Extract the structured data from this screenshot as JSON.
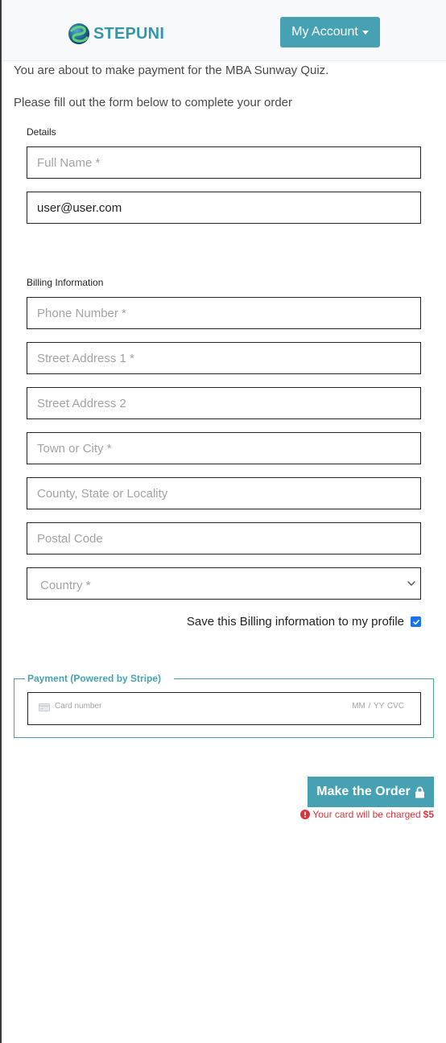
{
  "header": {
    "brand": "STEPUNI",
    "account_button": "My Account"
  },
  "intro": {
    "line1": "You are about to make payment for the MBA Sunway Quiz.",
    "line2": "Please fill out the form below to complete your order"
  },
  "details": {
    "label": "Details",
    "full_name_placeholder": "Full Name *",
    "email_value": "user@user.com"
  },
  "billing": {
    "label": "Billing Information",
    "phone_placeholder": "Phone Number *",
    "street1_placeholder": "Street Address 1 *",
    "street2_placeholder": "Street Address 2",
    "town_placeholder": "Town or City *",
    "county_placeholder": "County, State or Locality",
    "postal_placeholder": "Postal Code",
    "country_selected": "Country *",
    "save_label": "Save this Billing information to my profile",
    "save_checked": true
  },
  "payment": {
    "legend": "Payment (Powered by Stripe)",
    "card_placeholder": "Card number",
    "expiry_cvc_placeholder": "MM / YY  CVC"
  },
  "order": {
    "button_label": "Make the Order",
    "charge_note": "Your card will be charged",
    "charge_amount": "$5"
  },
  "colors": {
    "accent": "#46a1b2",
    "brand": "#3497a9",
    "danger": "#d8343c",
    "checkbox": "#1a73e8"
  }
}
